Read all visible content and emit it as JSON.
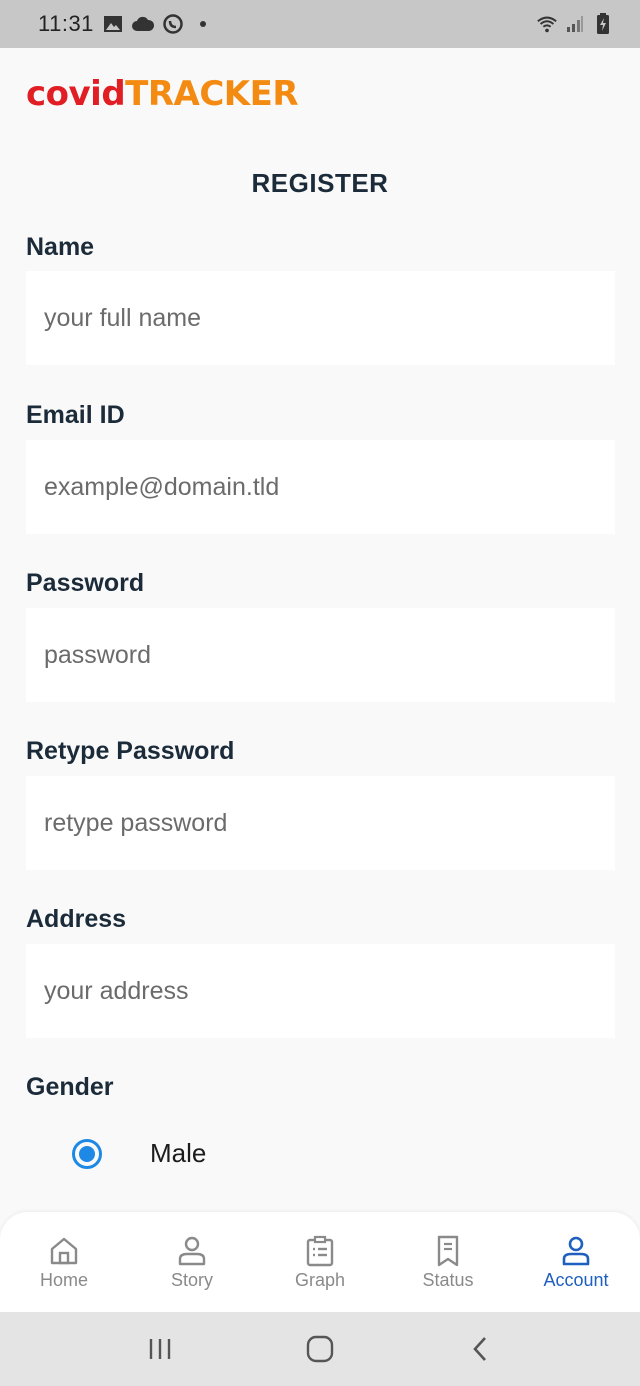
{
  "status_bar": {
    "time": "11:31",
    "icons": [
      "image-icon",
      "cloud-icon",
      "whatsapp-icon",
      "wifi-icon",
      "signal-icon",
      "battery-icon"
    ]
  },
  "logo": {
    "part1": "covid",
    "part2": "TRACKER"
  },
  "form": {
    "title": "REGISTER",
    "fields": [
      {
        "label": "Name",
        "placeholder": "your full name"
      },
      {
        "label": "Email ID",
        "placeholder": "example@domain.tld"
      },
      {
        "label": "Password",
        "placeholder": "password"
      },
      {
        "label": "Retype Password",
        "placeholder": "retype password"
      },
      {
        "label": "Address",
        "placeholder": "your address"
      }
    ],
    "gender": {
      "label": "Gender",
      "selected_option": "Male"
    }
  },
  "tabs": [
    {
      "label": "Home",
      "icon": "home-icon",
      "active": false
    },
    {
      "label": "Story",
      "icon": "person-icon",
      "active": false
    },
    {
      "label": "Graph",
      "icon": "clipboard-icon",
      "active": false
    },
    {
      "label": "Status",
      "icon": "document-icon",
      "active": false
    },
    {
      "label": "Account",
      "icon": "account-icon",
      "active": true
    }
  ],
  "colors": {
    "accent": "#1f5fbf",
    "radio": "#1e88e5",
    "logo_red": "#e01e24",
    "logo_orange": "#f38b12",
    "text_dark": "#1c2b3a"
  }
}
